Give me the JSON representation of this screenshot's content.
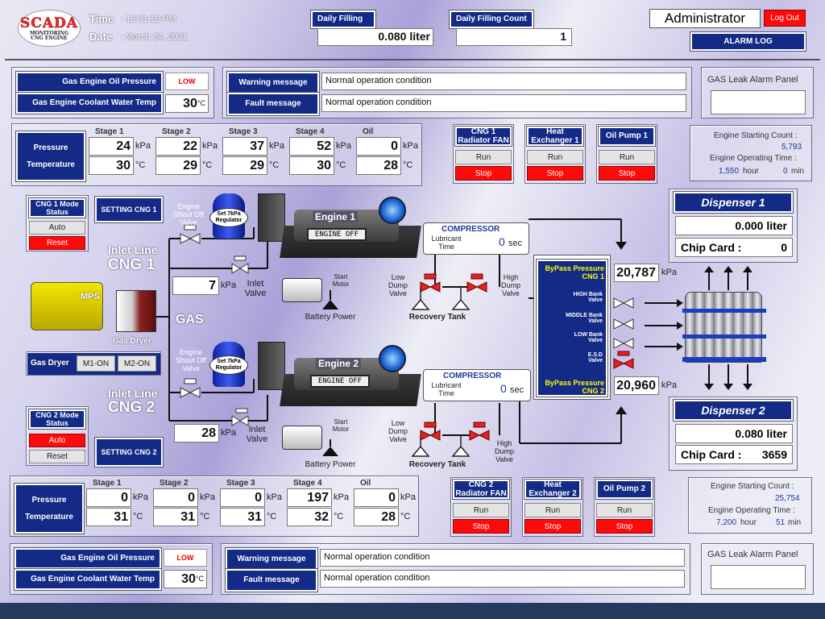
{
  "header": {
    "logo_title": "SCADA",
    "logo_sub": "MONITORING CNG ENGINE",
    "time_label": "Time",
    "time_value": ": 12:31:10 PM",
    "date_label": "Date",
    "date_value": ": March 24, 2021",
    "daily_filling_label": "Daily Filling",
    "daily_filling_value": "0.080 liter",
    "daily_count_label": "Daily Filling Count",
    "daily_count_value": "1",
    "user": "Administrator",
    "logout": "Log Out",
    "alarm_log": "ALARM LOG"
  },
  "engine1": {
    "oil_pressure_label": "Gas Engine Oil Pressure",
    "oil_pressure_value": "LOW",
    "coolant_label": "Gas Engine Coolant Water Temp",
    "coolant_value": "30",
    "coolant_unit": "°C",
    "warning_label": "Warning message",
    "warning_value": "Normal operation condition",
    "fault_label": "Fault message",
    "fault_value": "Normal operation condition",
    "gas_leak": "GAS Leak Alarm Panel",
    "stages": [
      "Stage 1",
      "Stage 2",
      "Stage 3",
      "Stage 4",
      "Oil"
    ],
    "pressure_label": "Pressure",
    "temperature_label": "Temperature",
    "pressure": [
      "24",
      "22",
      "37",
      "52",
      "0"
    ],
    "temperature": [
      "30",
      "29",
      "29",
      "30",
      "28"
    ],
    "p_unit": "kPa",
    "t_unit": "°C",
    "fan_label": "CNG 1 Radiator FAN",
    "hx_label": "Heat Exchanger 1",
    "pump_label": "Oil Pump 1",
    "run": "Run",
    "stop": "Stop",
    "start_count_label": "Engine Starting Count :",
    "start_count": "5,793",
    "op_time_label": "Engine Operating Time :",
    "op_hours": "1,550",
    "hour": "hour",
    "op_min": "0",
    "min": "min",
    "mode_status": "CNG 1 Mode Status",
    "auto": "Auto",
    "reset": "Reset",
    "setting": "SETTING CNG 1",
    "inlet_line": "Inlet Line",
    "cng": "CNG 1",
    "inlet_kpa": "7",
    "engine_name": "Engine 1",
    "engine_status": "ENGINE OFF",
    "compressor": "COMPRESSOR",
    "lub_time": "Lubricant Time",
    "lub_value": "0",
    "sec": "sec",
    "regulator": "Set 7kPa Regulator",
    "shutoff": "Engine Shout Off Valve",
    "inlet_valve": "Inlet Valve",
    "start_motor": "Start Motor",
    "battery": "Battery Power",
    "low_dump": "Low Dump Valve",
    "high_dump": "High Dump Valve",
    "recovery": "Recovery Tank"
  },
  "engine2": {
    "oil_pressure_label": "Gas Engine Oil Pressure",
    "oil_pressure_value": "LOW",
    "coolant_label": "Gas Engine Coolant Water Temp",
    "coolant_value": "30",
    "coolant_unit": "°C",
    "warning_label": "Warning message",
    "warning_value": "Normal operation condition",
    "fault_label": "Fault message",
    "fault_value": "Normal operation condition",
    "gas_leak": "GAS Leak Alarm Panel",
    "stages": [
      "Stage 1",
      "Stage 2",
      "Stage 3",
      "Stage 4",
      "Oil"
    ],
    "pressure_label": "Pressure",
    "temperature_label": "Temperature",
    "pressure": [
      "0",
      "0",
      "0",
      "197",
      "0"
    ],
    "temperature": [
      "31",
      "31",
      "31",
      "32",
      "28"
    ],
    "p_unit": "kPa",
    "t_unit": "°C",
    "fan_label": "CNG 2 Radiator FAN",
    "hx_label": "Heat Exchanger 2",
    "pump_label": "Oil Pump 2",
    "run": "Run",
    "stop": "Stop",
    "start_count_label": "Engine Starting Count :",
    "start_count": "25,754",
    "op_time_label": "Engine Operating Time :",
    "op_hours": "7,200",
    "hour": "hour",
    "op_min": "51",
    "min": "min",
    "mode_status": "CNG 2 Mode Status",
    "auto": "Auto",
    "reset": "Reset",
    "setting": "SETTING CNG 2",
    "inlet_line": "Inlet Line",
    "cng": "CNG 2",
    "inlet_kpa": "28",
    "engine_name": "Engine 2",
    "engine_status": "ENGINE OFF",
    "compressor": "COMPRESSOR",
    "lub_time": "Lubricant Time",
    "lub_value": "0",
    "sec": "sec",
    "regulator": "Set 7kPa Regulator",
    "shutoff": "Engine Shout Off Valve",
    "inlet_valve": "Inlet Valve",
    "start_motor": "Start Motor",
    "battery": "Battery Power",
    "low_dump": "Low Dump Valve",
    "high_dump": "High Dump Valve",
    "recovery": "Recovery Tank"
  },
  "middle": {
    "mps": "MPS",
    "gas_dryer": "Gas Dryer",
    "gas": "GAS",
    "dryer_label": "Gas Dryer",
    "m1": "M1-ON",
    "m2": "M2-ON"
  },
  "bypass": {
    "bp1_label": "ByPass Pressure CNG 1",
    "bp1_value": "20,787",
    "bp2_label": "ByPass Pressure CNG 2",
    "bp2_value": "20,960",
    "unit": "kPa",
    "high": "HIGH Bank Valve",
    "middle": "MIDDLE Bank Valve",
    "low": "LOW Bank Valve",
    "esd": "E.S.D Valve"
  },
  "dispenser1": {
    "title": "Dispenser 1",
    "value": "0.000 liter",
    "chip_label": "Chip Card :",
    "chip": "0"
  },
  "dispenser2": {
    "title": "Dispenser 2",
    "value": "0.080 liter",
    "chip_label": "Chip Card :",
    "chip": "3659"
  },
  "colors": {
    "navy": "#132a86",
    "red": "#ff0a0a",
    "blue_text": "#1b3a9a"
  }
}
